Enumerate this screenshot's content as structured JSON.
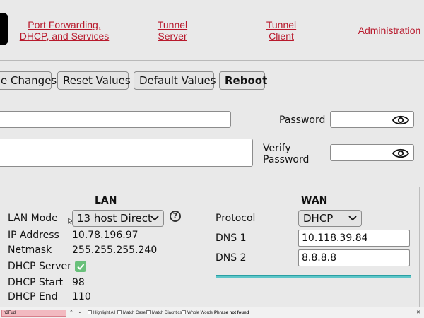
{
  "nav": {
    "links": [
      {
        "line1": "Port Forwarding,",
        "line2": "DHCP, and Services"
      },
      {
        "line1": "Tunnel",
        "line2": "Server"
      },
      {
        "line1": "Tunnel",
        "line2": "Client"
      },
      {
        "line1": "Administration",
        "line2": ""
      }
    ]
  },
  "actions": {
    "save": "e Changes",
    "reset": "Reset Values",
    "default": "Default Values",
    "reboot": "Reboot"
  },
  "credentials": {
    "password_label": "Password",
    "verify_label_1": "Verify",
    "verify_label_2": "Password"
  },
  "lan": {
    "title": "LAN",
    "mode_label": "LAN Mode",
    "mode_value": "13 host Direct",
    "ip_label": "IP Address",
    "ip_value": "10.78.196.97",
    "netmask_label": "Netmask",
    "netmask_value": "255.255.255.240",
    "dhcp_server_label": "DHCP Server",
    "dhcp_start_label": "DHCP Start",
    "dhcp_start_value": "98",
    "dhcp_end_label": "DHCP End",
    "dhcp_end_value": "110",
    "help_glyph": "?"
  },
  "wan": {
    "title": "WAN",
    "protocol_label": "Protocol",
    "protocol_value": "DHCP",
    "dns1_label": "DNS 1",
    "dns1_value": "10.118.39.84",
    "dns2_label": "DNS 2",
    "dns2_value": "8.8.8.8"
  },
  "findbar": {
    "query": "n3Fud",
    "highlight_all": "Highlight All",
    "match_case": "Match Case",
    "match_diacritics": "Match Diacritics",
    "whole_words": "Whole Words",
    "status": "Phrase not found",
    "prev_glyph": "⌃",
    "next_glyph": "⌄",
    "close_glyph": "✕"
  },
  "colors": {
    "link": "#b8192c",
    "accent_bar": "#5ec6c9",
    "check": "#69c07a",
    "find_not_found": "#f2b9c0"
  }
}
